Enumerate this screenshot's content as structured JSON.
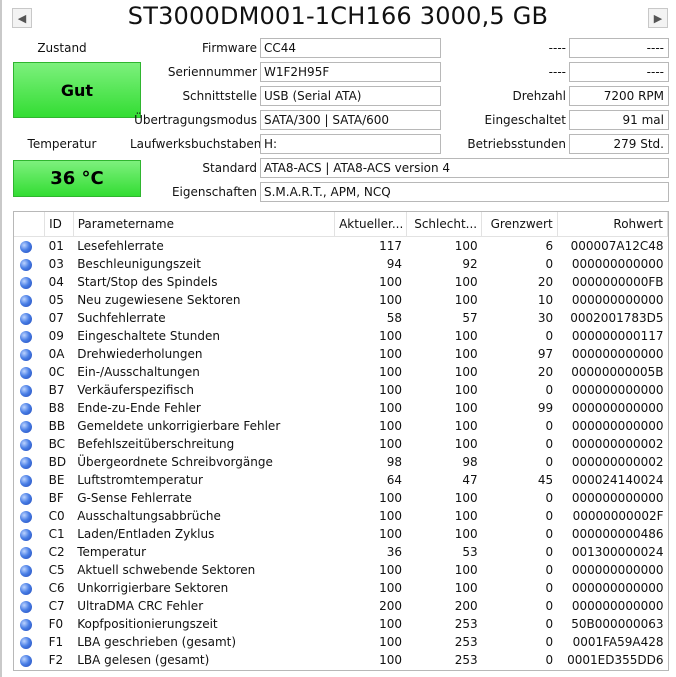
{
  "header": {
    "title": "ST3000DM001-1CH166 3000,5 GB",
    "prev_icon": "◀",
    "next_icon": "▶"
  },
  "left": {
    "status_label": "Zustand",
    "status_value": "Gut",
    "temp_label": "Temperatur",
    "temp_value": "36 °C",
    "status_color": "#33dd33"
  },
  "info": {
    "firmware_label": "Firmware",
    "firmware_value": "CC44",
    "serial_label": "Seriennummer",
    "serial_value": "W1F2H95F",
    "interface_label": "Schnittstelle",
    "interface_value": "USB (Serial ATA)",
    "transfer_label": "Übertragungsmodus",
    "transfer_value": "SATA/300 | SATA/600",
    "drive_letter_label": "Laufwerksbuchstaben",
    "drive_letter_value": "H:",
    "standard_label": "Standard",
    "standard_value": "ATA8-ACS | ATA8-ACS version 4",
    "features_label": "Eigenschaften",
    "features_value": "S.M.A.R.T., APM, NCQ"
  },
  "right": {
    "blank1_label": "----",
    "blank1_value": "----",
    "blank2_label": "----",
    "blank2_value": "----",
    "rpm_label": "Drehzahl",
    "rpm_value": "7200 RPM",
    "powered_label": "Eingeschaltet",
    "powered_value": "91 mal",
    "hours_label": "Betriebsstunden",
    "hours_value": "279 Std."
  },
  "smart": {
    "columns": [
      "",
      "ID",
      "Parametername",
      "Aktueller...",
      "Schlecht...",
      "Grenzwert",
      "Rohwert"
    ],
    "rows": [
      {
        "id": "01",
        "name": "Lesefehlerrate",
        "current": "117",
        "worst": "100",
        "threshold": "6",
        "raw": "000007A12C48"
      },
      {
        "id": "03",
        "name": "Beschleunigungszeit",
        "current": "94",
        "worst": "92",
        "threshold": "0",
        "raw": "000000000000"
      },
      {
        "id": "04",
        "name": "Start/Stop des Spindels",
        "current": "100",
        "worst": "100",
        "threshold": "20",
        "raw": "0000000000FB"
      },
      {
        "id": "05",
        "name": "Neu zugewiesene Sektoren",
        "current": "100",
        "worst": "100",
        "threshold": "10",
        "raw": "000000000000"
      },
      {
        "id": "07",
        "name": "Suchfehlerrate",
        "current": "58",
        "worst": "57",
        "threshold": "30",
        "raw": "0002001783D5"
      },
      {
        "id": "09",
        "name": "Eingeschaltete Stunden",
        "current": "100",
        "worst": "100",
        "threshold": "0",
        "raw": "000000000117"
      },
      {
        "id": "0A",
        "name": "Drehwiederholungen",
        "current": "100",
        "worst": "100",
        "threshold": "97",
        "raw": "000000000000"
      },
      {
        "id": "0C",
        "name": "Ein-/Ausschaltungen",
        "current": "100",
        "worst": "100",
        "threshold": "20",
        "raw": "00000000005B"
      },
      {
        "id": "B7",
        "name": "Verkäuferspezifisch",
        "current": "100",
        "worst": "100",
        "threshold": "0",
        "raw": "000000000000"
      },
      {
        "id": "B8",
        "name": "Ende-zu-Ende Fehler",
        "current": "100",
        "worst": "100",
        "threshold": "99",
        "raw": "000000000000"
      },
      {
        "id": "BB",
        "name": "Gemeldete unkorrigierbare Fehler",
        "current": "100",
        "worst": "100",
        "threshold": "0",
        "raw": "000000000000"
      },
      {
        "id": "BC",
        "name": "Befehlszeitüberschreitung",
        "current": "100",
        "worst": "100",
        "threshold": "0",
        "raw": "000000000002"
      },
      {
        "id": "BD",
        "name": "Übergeordnete Schreibvorgänge",
        "current": "98",
        "worst": "98",
        "threshold": "0",
        "raw": "000000000002"
      },
      {
        "id": "BE",
        "name": "Luftstromtemperatur",
        "current": "64",
        "worst": "47",
        "threshold": "45",
        "raw": "000024140024"
      },
      {
        "id": "BF",
        "name": "G-Sense Fehlerrate",
        "current": "100",
        "worst": "100",
        "threshold": "0",
        "raw": "000000000000"
      },
      {
        "id": "C0",
        "name": "Ausschaltungsabbrüche",
        "current": "100",
        "worst": "100",
        "threshold": "0",
        "raw": "00000000002F"
      },
      {
        "id": "C1",
        "name": "Laden/Entladen Zyklus",
        "current": "100",
        "worst": "100",
        "threshold": "0",
        "raw": "000000000486"
      },
      {
        "id": "C2",
        "name": "Temperatur",
        "current": "36",
        "worst": "53",
        "threshold": "0",
        "raw": "001300000024"
      },
      {
        "id": "C5",
        "name": "Aktuell schwebende Sektoren",
        "current": "100",
        "worst": "100",
        "threshold": "0",
        "raw": "000000000000"
      },
      {
        "id": "C6",
        "name": "Unkorrigierbare Sektoren",
        "current": "100",
        "worst": "100",
        "threshold": "0",
        "raw": "000000000000"
      },
      {
        "id": "C7",
        "name": "UltraDMA CRC Fehler",
        "current": "200",
        "worst": "200",
        "threshold": "0",
        "raw": "000000000000"
      },
      {
        "id": "F0",
        "name": "Kopfpositionierungszeit",
        "current": "100",
        "worst": "253",
        "threshold": "0",
        "raw": "50B000000063"
      },
      {
        "id": "F1",
        "name": "LBA geschrieben (gesamt)",
        "current": "100",
        "worst": "253",
        "threshold": "0",
        "raw": "0001FA59A428"
      },
      {
        "id": "F2",
        "name": "LBA gelesen (gesamt)",
        "current": "100",
        "worst": "253",
        "threshold": "0",
        "raw": "0001ED355DD6"
      }
    ]
  }
}
